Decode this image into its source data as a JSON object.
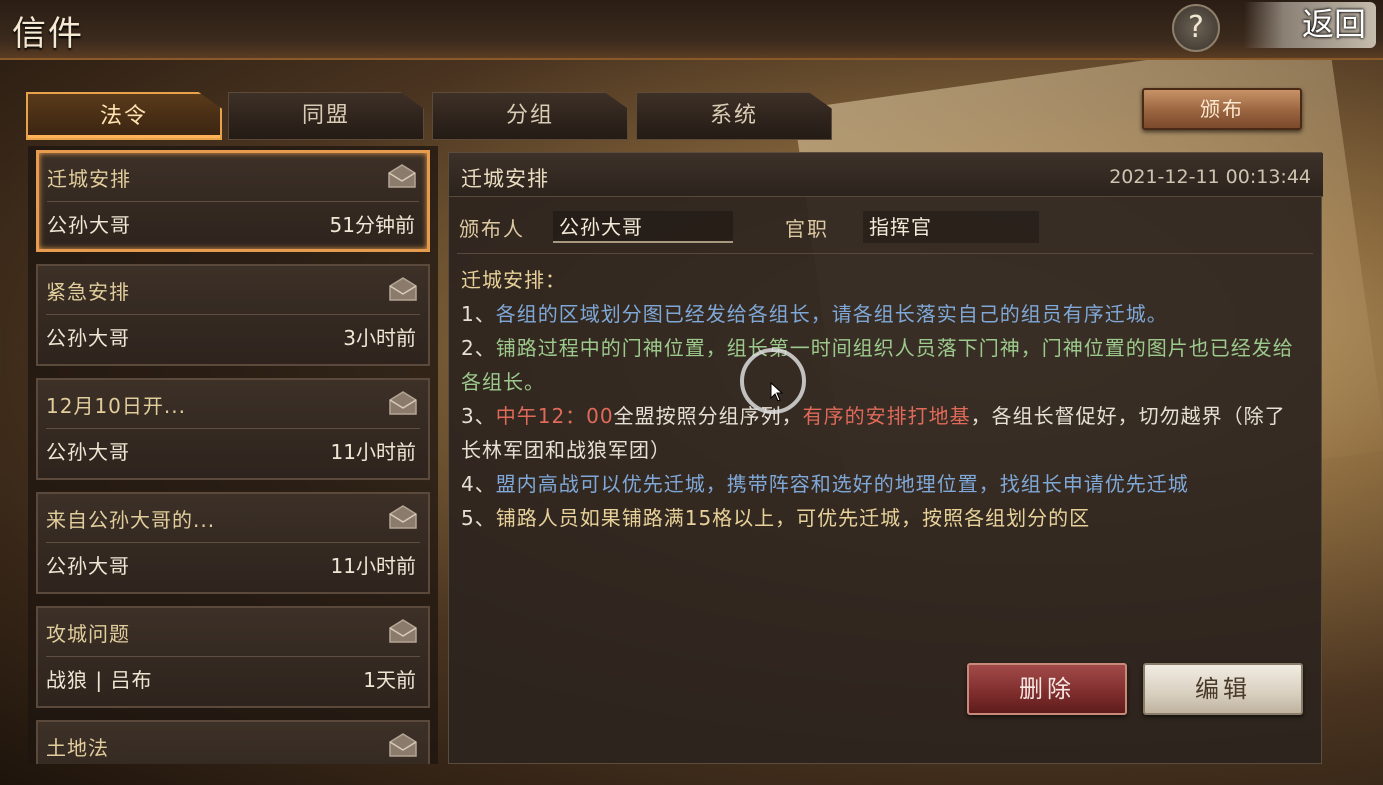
{
  "header": {
    "title": "信件",
    "help_label": "?",
    "back_label": "返回"
  },
  "tabs": [
    {
      "label": "法令",
      "active": true
    },
    {
      "label": "同盟",
      "active": false
    },
    {
      "label": "分组",
      "active": false
    },
    {
      "label": "系统",
      "active": false
    }
  ],
  "publish_label": "颁布",
  "mail_list": [
    {
      "subject": "迁城安排",
      "sender": "公孙大哥",
      "time": "51分钟前",
      "selected": true
    },
    {
      "subject": "紧急安排",
      "sender": "公孙大哥",
      "time": "3小时前",
      "selected": false
    },
    {
      "subject": "12月10日开...",
      "sender": "公孙大哥",
      "time": "11小时前",
      "selected": false
    },
    {
      "subject": "来自公孙大哥的...",
      "sender": "公孙大哥",
      "time": "11小时前",
      "selected": false
    },
    {
      "subject": "攻城问题",
      "sender": "战狼 | 吕布",
      "time": "1天前",
      "selected": false
    },
    {
      "subject": "土地法",
      "sender": "",
      "time": "",
      "selected": false
    }
  ],
  "detail": {
    "subject": "迁城安排",
    "datetime": "2021-12-11 00:13:44",
    "publisher_label": "颁布人",
    "publisher": "公孙大哥",
    "rank_label": "官职",
    "rank": "指挥官",
    "body_intro": "迁城安排：",
    "body": [
      {
        "prefix": "1、",
        "parts": [
          {
            "text": "各组的区域划分图已经发给各组长，请各组长落实自己的组员有序迁城。",
            "color": "blue"
          }
        ]
      },
      {
        "prefix": "2、",
        "parts": [
          {
            "text": "铺路过程中的门神位置，组长第一时间组织人员落下门神，门神位置的图片也已经发给各组长。",
            "color": "green"
          }
        ]
      },
      {
        "prefix": "3、",
        "parts": [
          {
            "text": "中午12：00",
            "color": "red"
          },
          {
            "text": "全盟按照分组序列，",
            "color": "white"
          },
          {
            "text": "有序的安排打地基",
            "color": "red"
          },
          {
            "text": "，各组长督促好，切勿越界（除了长林军团和战狼军团）",
            "color": "white"
          }
        ]
      },
      {
        "prefix": "4、",
        "parts": [
          {
            "text": "盟内高战可以优先迁城，携带阵容和选好的地理位置，找组长申请优先迁城",
            "color": "blue"
          }
        ]
      },
      {
        "prefix": "5、",
        "parts": [
          {
            "text": "铺路人员如果铺路满15格以上，可优先迁城，按照各组划分的区",
            "color": "gold"
          }
        ]
      }
    ],
    "delete_label": "删除",
    "edit_label": "编辑"
  },
  "colors": {
    "accent_orange": "#e79b4f",
    "text_blue": "#7fa8d8",
    "text_green": "#9cc98c",
    "text_red": "#e06a5a",
    "text_gold": "#e8d29a"
  }
}
